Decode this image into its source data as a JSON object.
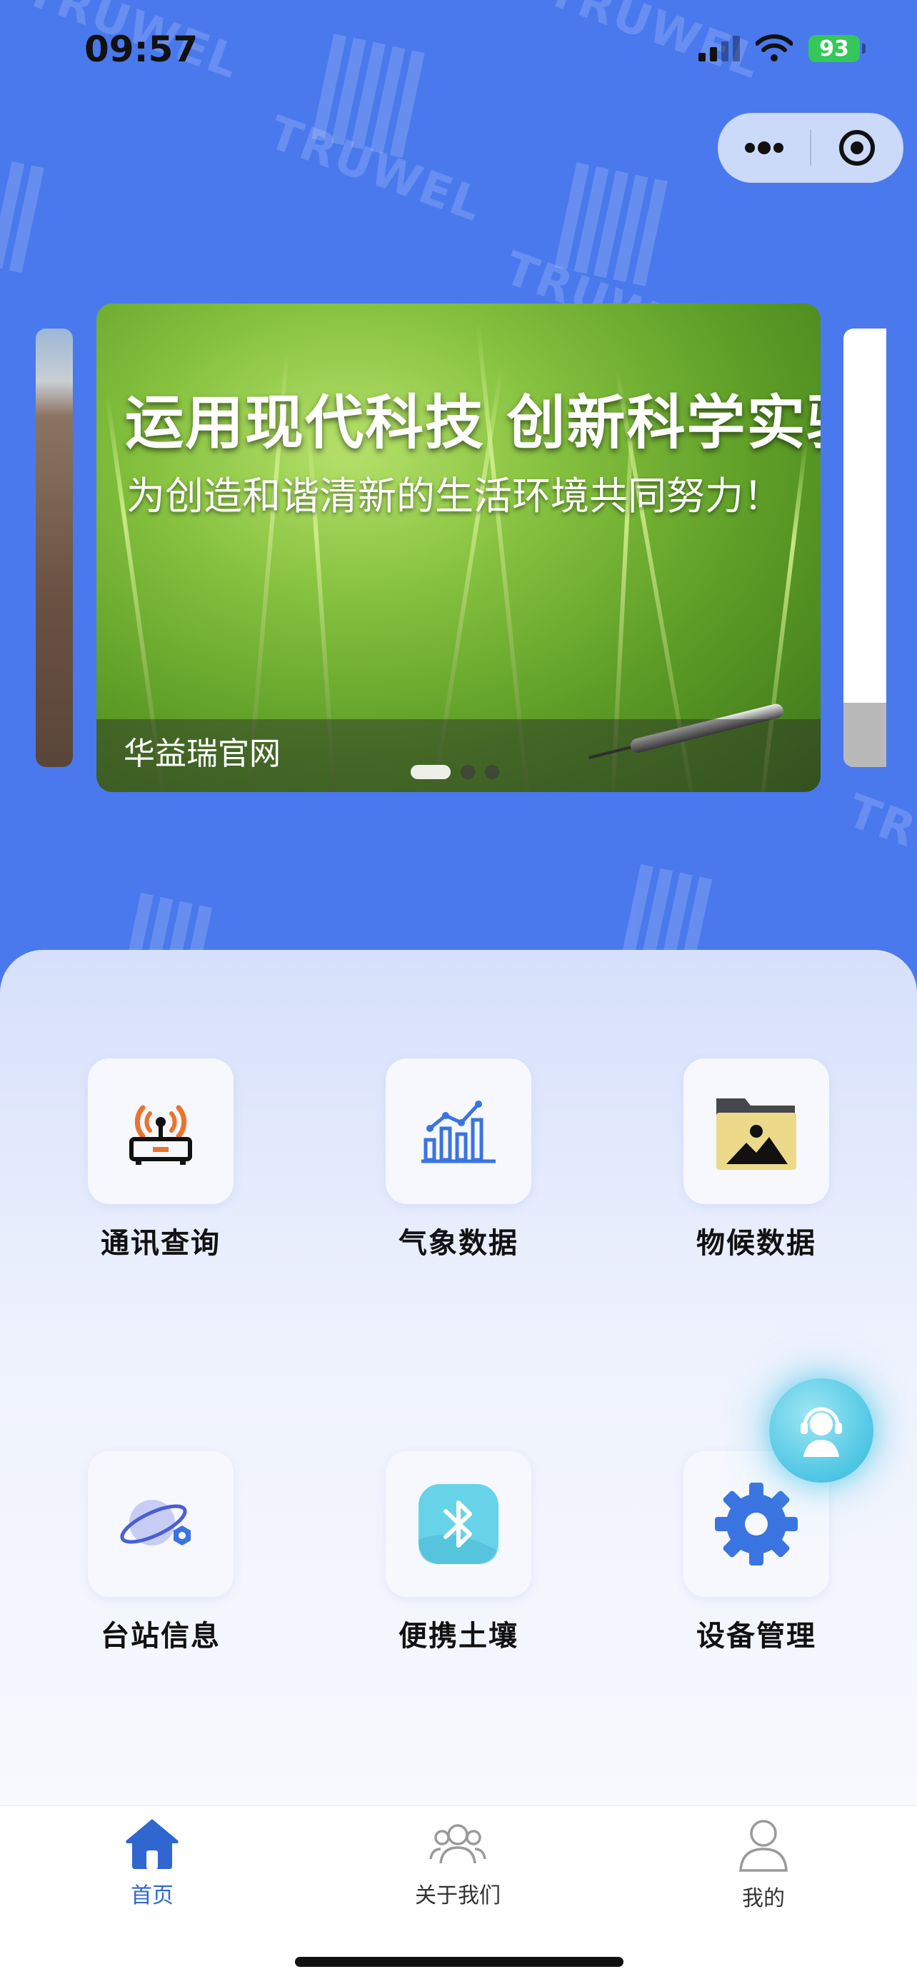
{
  "status_bar": {
    "time": "09:57",
    "battery": "93"
  },
  "watermark": "TRUWEL",
  "capsule": {
    "more_icon": "more-dots-icon",
    "close_icon": "target-icon"
  },
  "banner": {
    "title": "运用现代科技  创新科学实验",
    "subtitle": "为创造和谐清新的生活环境共同努力！",
    "caption": "华益瑞官网",
    "slide_count": 3,
    "active_slide": 1
  },
  "menu": [
    {
      "label": "通讯查询",
      "icon": "router-icon"
    },
    {
      "label": "气象数据",
      "icon": "bar-chart-icon"
    },
    {
      "label": "物候数据",
      "icon": "photo-folder-icon"
    },
    {
      "label": "台站信息",
      "icon": "planet-icon"
    },
    {
      "label": "便携土壤",
      "icon": "bluetooth-icon"
    },
    {
      "label": "设备管理",
      "icon": "gear-icon"
    }
  ],
  "fab_icon": "customer-service-icon",
  "tabbar": [
    {
      "label": "首页",
      "icon": "home-icon",
      "active": true
    },
    {
      "label": "关于我们",
      "icon": "group-icon",
      "active": false
    },
    {
      "label": "我的",
      "icon": "user-icon",
      "active": false
    }
  ],
  "colors": {
    "primary": "#4a79ed",
    "tab_active": "#2f66d0",
    "icon_blue": "#3a74e0",
    "icon_orange": "#e8742d"
  }
}
